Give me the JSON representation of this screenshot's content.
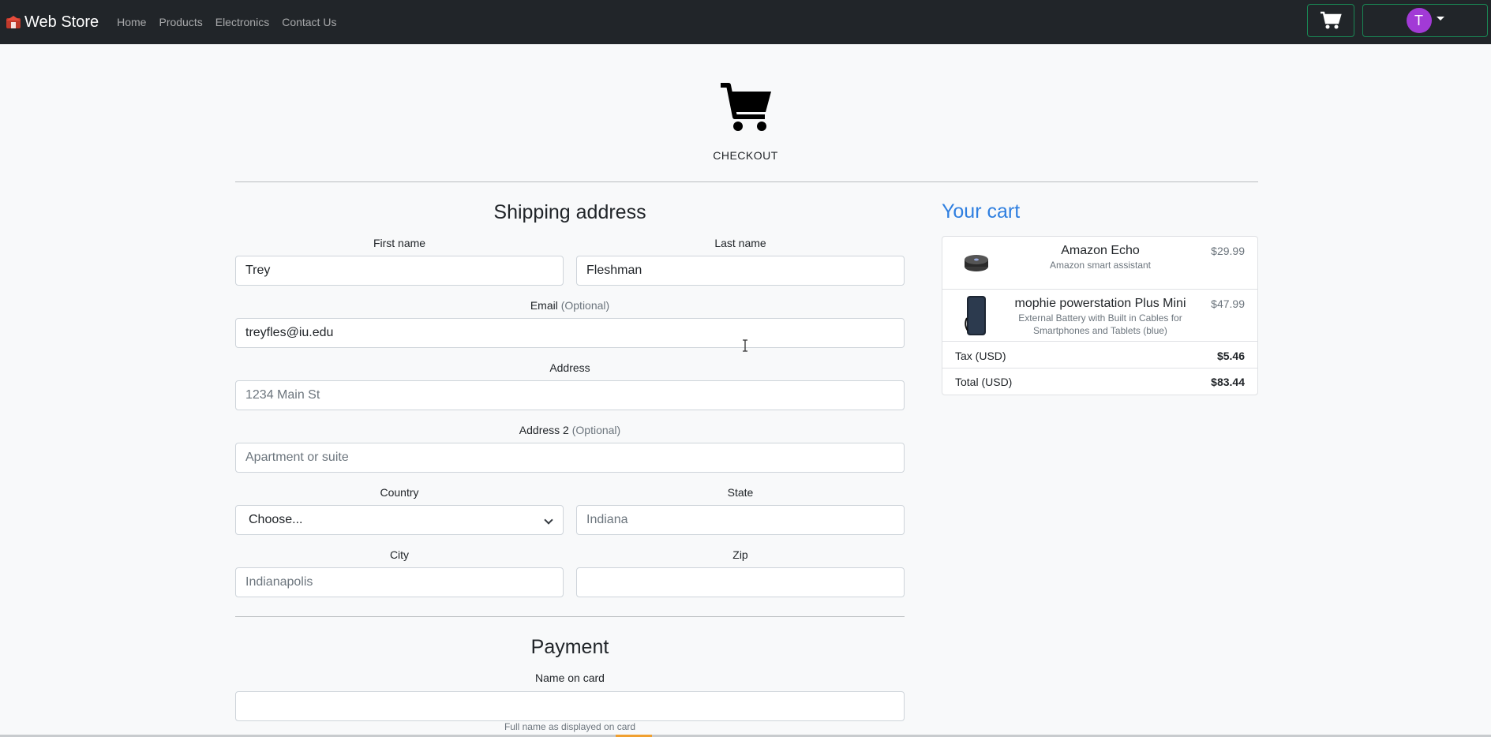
{
  "navbar": {
    "brand": "Web Store",
    "links": [
      "Home",
      "Products",
      "Electronics",
      "Contact Us"
    ],
    "avatar_letter": "T",
    "accent_color": "#198754",
    "avatar_color": "#a23ad6"
  },
  "header": {
    "title": "CHECKOUT",
    "icon": "shopping-cart-icon"
  },
  "shipping": {
    "title": "Shipping address",
    "first_name_label": "First name",
    "first_name_value": "Trey",
    "last_name_label": "Last name",
    "last_name_value": "Fleshman",
    "email_label": "Email",
    "email_optional": "(Optional)",
    "email_value": "treyfles@iu.edu",
    "address_label": "Address",
    "address_placeholder": "1234 Main St",
    "address2_label": "Address 2",
    "address2_optional": "(Optional)",
    "address2_placeholder": "Apartment or suite",
    "country_label": "Country",
    "country_value": "Choose...",
    "state_label": "State",
    "state_placeholder": "Indiana",
    "city_label": "City",
    "city_placeholder": "Indianapolis",
    "zip_label": "Zip",
    "zip_value": ""
  },
  "payment": {
    "title": "Payment",
    "name_on_card_label": "Name on card",
    "name_on_card_value": "",
    "name_on_card_help": "Full name as displayed on card"
  },
  "cart": {
    "title": "Your cart",
    "title_color": "#2f7fe0",
    "items": [
      {
        "name": "Amazon Echo",
        "description": "Amazon smart assistant",
        "price": "$29.99"
      },
      {
        "name": "mophie powerstation Plus Mini",
        "description": "External Battery with Built in Cables for Smartphones and Tablets (blue)",
        "price": "$47.99"
      }
    ],
    "tax_label": "Tax (USD)",
    "tax_value": "$5.46",
    "total_label": "Total (USD)",
    "total_value": "$83.44"
  }
}
